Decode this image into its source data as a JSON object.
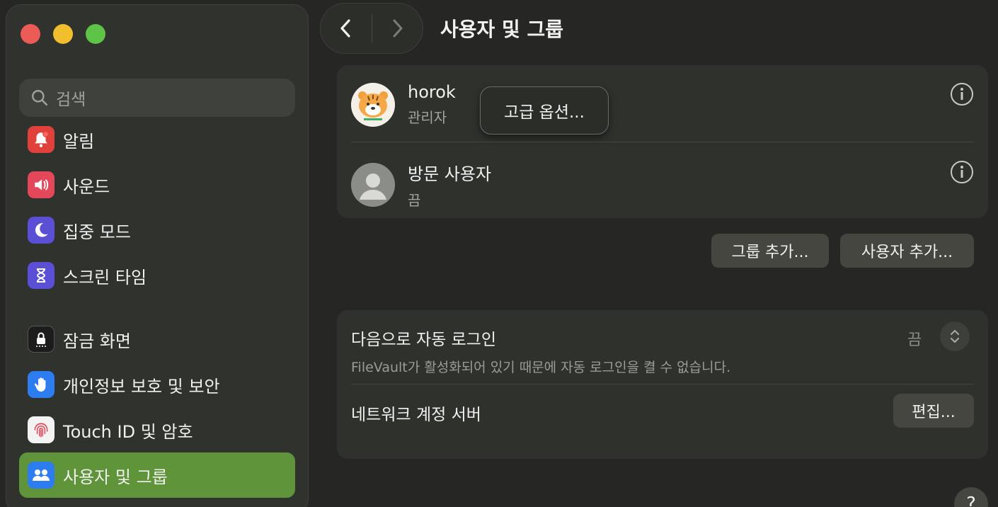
{
  "window": {
    "title": "사용자 및 그룹"
  },
  "sidebar": {
    "search_placeholder": "검색",
    "items": [
      {
        "label": "알림",
        "icon": "bell-icon",
        "color": "#e0413b"
      },
      {
        "label": "사운드",
        "icon": "speaker-icon",
        "color": "#e2475a"
      },
      {
        "label": "집중 모드",
        "icon": "moon-icon",
        "color": "#5b4fd6"
      },
      {
        "label": "스크린 타임",
        "icon": "hourglass-icon",
        "color": "#5b4fd6"
      },
      {
        "label": "잠금 화면",
        "icon": "lock-icon",
        "color": "#1c1c1c"
      },
      {
        "label": "개인정보 보호 및 보안",
        "icon": "hand-icon",
        "color": "#2d7cf0"
      },
      {
        "label": "Touch ID 및 암호",
        "icon": "fingerprint-icon",
        "color": "#f3f3f3"
      },
      {
        "label": "사용자 및 그룹",
        "icon": "users-icon",
        "color": "#2d7cf0",
        "active": true
      }
    ]
  },
  "users": [
    {
      "name": "horok",
      "role": "관리자",
      "avatar": "tiger-avatar"
    },
    {
      "name": "방문 사용자",
      "role": "끔",
      "avatar": "guest-avatar"
    }
  ],
  "advanced_options_label": "고급 옵션...",
  "buttons": {
    "add_group": "그룹 추가...",
    "add_user": "사용자 추가...",
    "edit": "편집..."
  },
  "auto_login": {
    "title": "다음으로 자동 로그인",
    "subtitle": "FileVault가 활성화되어 있기 때문에 자동 로그인을 켤 수 없습니다.",
    "value": "끔"
  },
  "network_server": {
    "title": "네트워크 계정 서버"
  },
  "help_label": "?",
  "colors": {
    "accent_active": "#5f943a",
    "background": "#262725"
  }
}
